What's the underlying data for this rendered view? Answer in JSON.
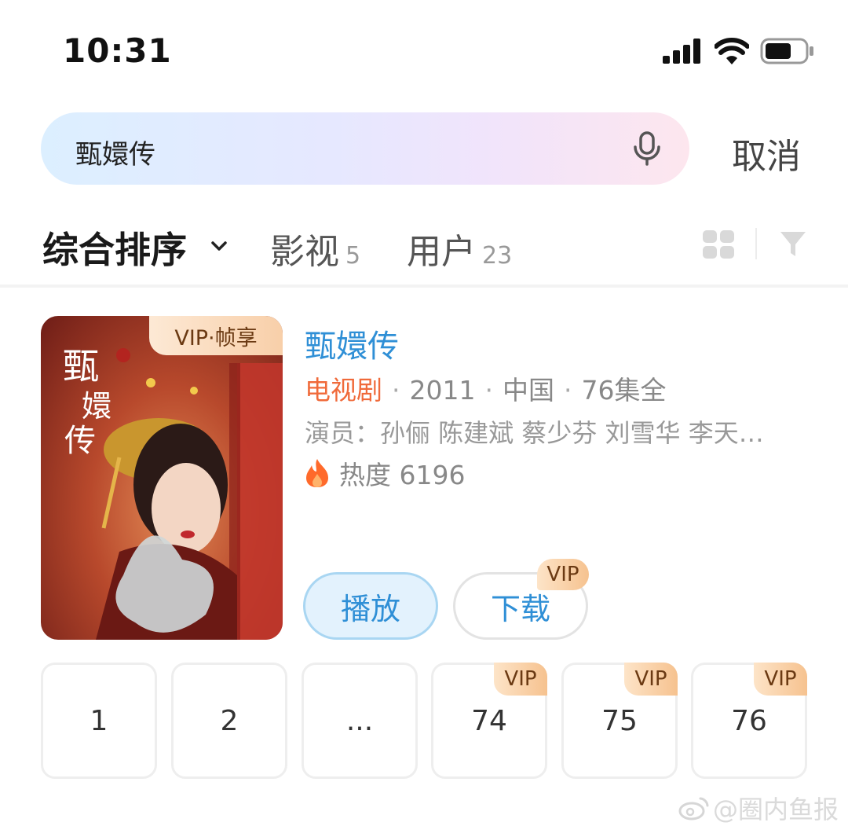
{
  "status_bar": {
    "time": "10:31"
  },
  "search": {
    "query": "甄嬛传",
    "cancel_label": "取消"
  },
  "tabs": {
    "sort_label": "综合排序",
    "items": [
      {
        "label": "影视",
        "count": "5"
      },
      {
        "label": "用户",
        "count": "23"
      }
    ]
  },
  "result": {
    "poster_badge": "VIP·帧享",
    "title": "甄嬛传",
    "genre": "电视剧",
    "year": "2011",
    "region": "中国",
    "episodes_info": "76集全",
    "cast": "演员：孙俪 陈建斌 蔡少芬 刘雪华 李天…",
    "heat": "热度 6196",
    "play_label": "播放",
    "download_label": "下载",
    "download_badge": "VIP"
  },
  "episodes": [
    {
      "label": "1",
      "badge": ""
    },
    {
      "label": "2",
      "badge": ""
    },
    {
      "label": "...",
      "badge": ""
    },
    {
      "label": "74",
      "badge": "VIP"
    },
    {
      "label": "75",
      "badge": "VIP"
    },
    {
      "label": "76",
      "badge": "VIP"
    }
  ],
  "watermark": "@圈内鱼报",
  "colors": {
    "accent_blue": "#2f8fd6",
    "genre_orange": "#f06a3a",
    "vip_gold": "#f6c28f"
  }
}
